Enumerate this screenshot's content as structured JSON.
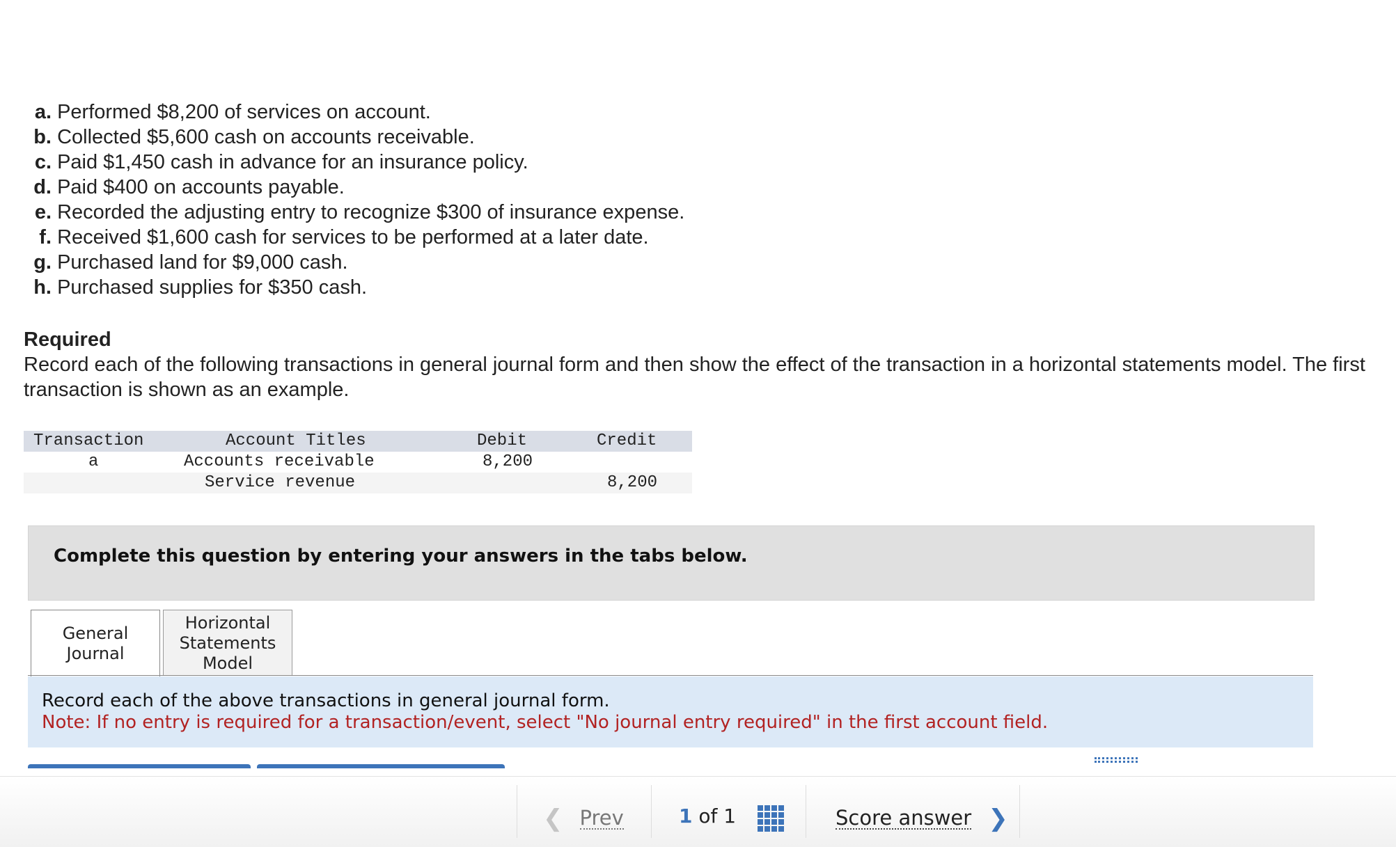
{
  "transactions": [
    {
      "letter": "a.",
      "text": "Performed $8,200 of services on account."
    },
    {
      "letter": "b.",
      "text": "Collected $5,600 cash on accounts receivable."
    },
    {
      "letter": "c.",
      "text": "Paid $1,450 cash in advance for an insurance policy."
    },
    {
      "letter": "d.",
      "text": "Paid $400 on accounts payable."
    },
    {
      "letter": "e.",
      "text": "Recorded the adjusting entry to recognize $300 of insurance expense."
    },
    {
      "letter": "f.",
      "text": "Received $1,600 cash for services to be performed at a later date."
    },
    {
      "letter": "g.",
      "text": "Purchased land for $9,000 cash."
    },
    {
      "letter": "h.",
      "text": "Purchased supplies for $350 cash."
    }
  ],
  "required": {
    "title": "Required",
    "text": "Record each of the following transactions in general journal form and then show the effect of the transaction in a horizontal statements model. The first transaction is shown as an example."
  },
  "example_table": {
    "headers": {
      "transaction": "Transaction",
      "account": "Account Titles",
      "debit": "Debit",
      "credit": "Credit"
    },
    "rows": [
      {
        "transaction": "a",
        "account": "Accounts receivable",
        "debit": "8,200",
        "credit": ""
      },
      {
        "transaction": "",
        "account": "Service revenue",
        "debit": "",
        "credit": "8,200"
      }
    ]
  },
  "instruction": "Complete this question by entering your answers in the tabs below.",
  "tabs": [
    {
      "label": "General\nJournal",
      "active": true
    },
    {
      "label": "Horizontal\nStatements\nModel",
      "active": false
    }
  ],
  "note": {
    "line1": "Record each of the above transactions in general journal form.",
    "line2": "Note: If no entry is required for a transaction/event, select \"No journal entry required\" in the first account field."
  },
  "nav": {
    "prev_label": "Prev",
    "page_current": "1",
    "page_of": "of",
    "page_total": "1",
    "score_label": "Score answer",
    "accent_color": "#3d74b9"
  }
}
